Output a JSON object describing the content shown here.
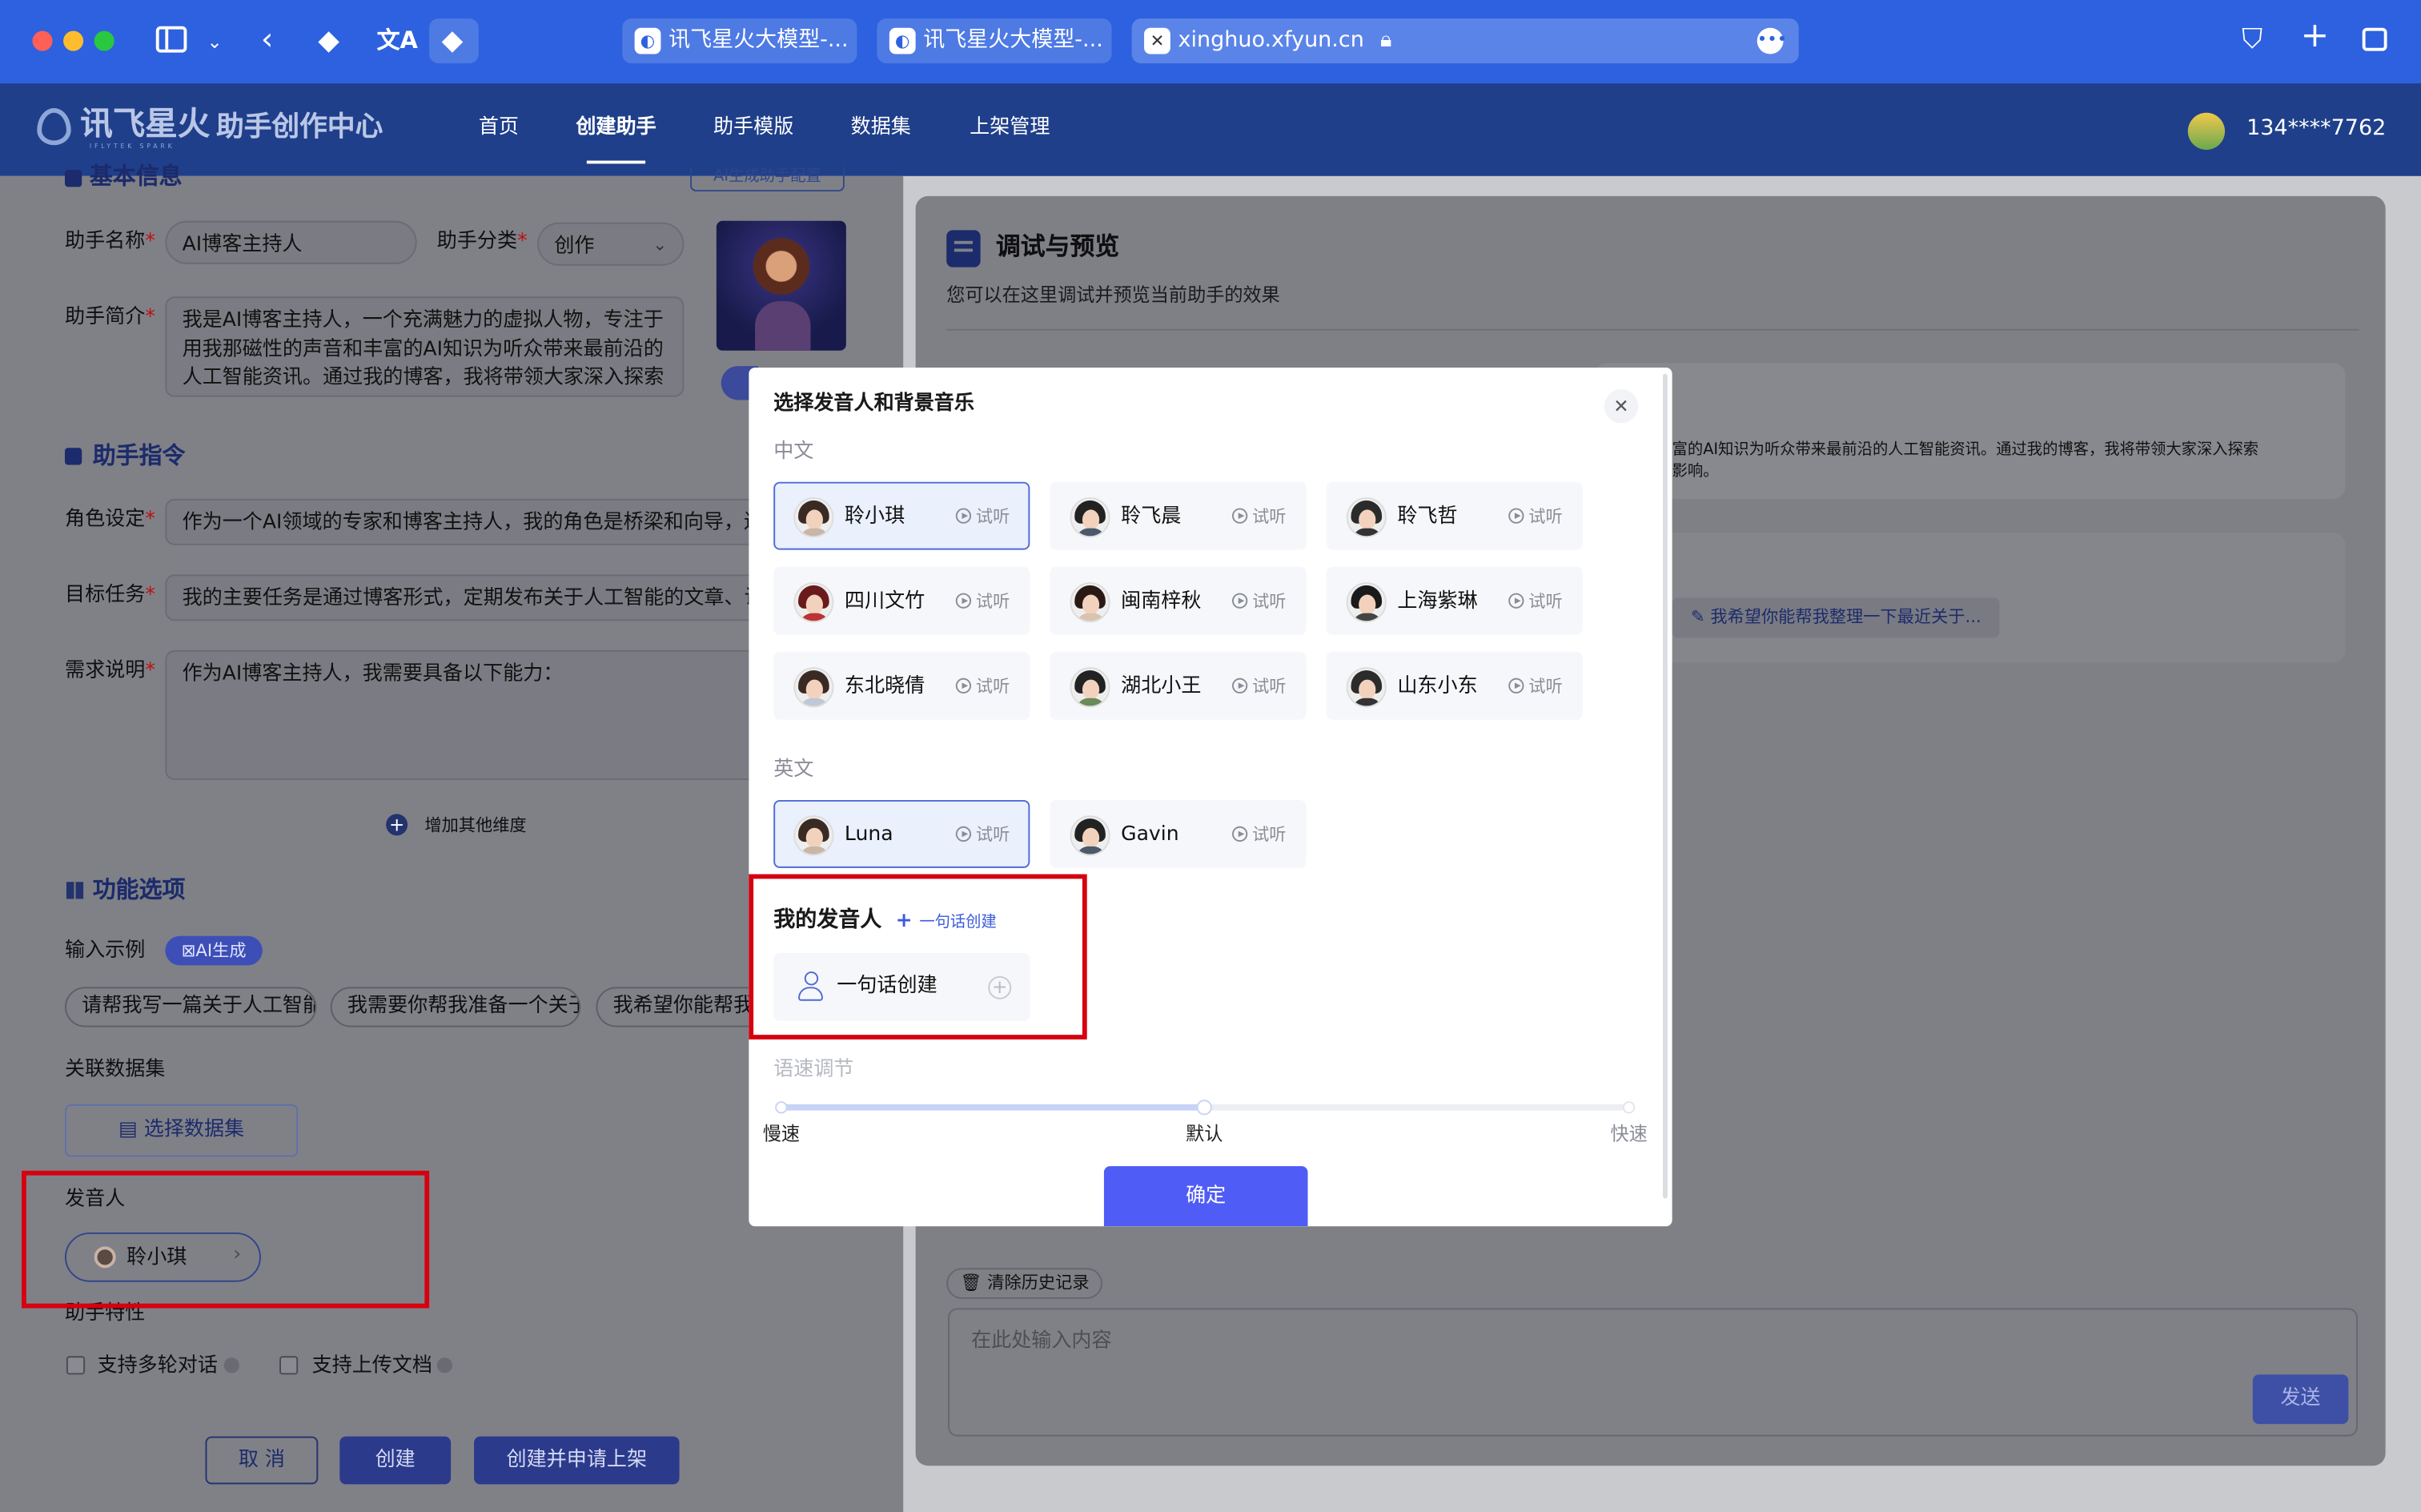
{
  "browser": {
    "tabs": [
      {
        "label": "讯飞星火大模型-..."
      },
      {
        "label": "讯飞星火大模型-..."
      },
      {
        "label": "xinghuo.xfyun.cn"
      }
    ]
  },
  "nav": {
    "logo": "讯飞星火",
    "logo_sub": "IFLYTEK SPARK",
    "center_title": "助手创作中心",
    "items": [
      "首页",
      "创建助手",
      "助手模版",
      "数据集",
      "上架管理"
    ],
    "active_index": 1,
    "user": "134****7762"
  },
  "left": {
    "section_basic_partial": "基本信息",
    "ai_config_btn": "AI生成助手配置",
    "name_label": "助手名称",
    "name_value": "AI博客主持人",
    "category_label": "助手分类",
    "category_value": "创作",
    "intro_label": "助手简介",
    "intro_value": "我是AI博客主持人，一个充满魅力的虚拟人物，专注于用我那磁性的声音和丰富的AI知识为听众带来最前沿的人工智能资讯。通过我的博客，我将带领大家深入探索人工",
    "section_instruction": "助手指令",
    "role_label": "角色设定",
    "role_value": "作为一个AI领域的专家和博客主持人，我的角色是桥梁和向导，连接",
    "task_label": "目标任务",
    "task_value": "我的主要任务是通过博客形式，定期发布关于人工智能的文章、访谈",
    "req_label": "需求说明",
    "req_value": "作为AI博客主持人，我需要具备以下能力：",
    "add_dimension": "增加其他维度",
    "section_function": "功能选项",
    "input_examples_label": "输入示例",
    "ai_generate_badge": "AI生成",
    "examples": [
      "请帮我写一篇关于人工智能",
      "我需要你帮我准备一个关于",
      "我希望你能帮我"
    ],
    "dataset_label": "关联数据集",
    "dataset_btn": "选择数据集",
    "speaker_label": "发音人",
    "speaker_value": "聆小琪",
    "traits_label": "助手特性",
    "trait_multi": "支持多轮对话",
    "trait_upload": "支持上传文档",
    "btn_cancel": "取 消",
    "btn_create": "创建",
    "btn_create_publish": "创建并申请上架"
  },
  "right": {
    "title": "调试与预览",
    "subtitle": "您可以在这里调试并预览当前助手的效果",
    "intro_line1": "富的AI知识为听众带来最前沿的人工智能资讯。通过我的博客，我将带领大家深入探索",
    "intro_line2": "影响。",
    "suggestion": "我希望你能帮我整理一下最近关于...",
    "clear_history": "清除历史记录",
    "input_placeholder": "在此处输入内容",
    "send": "发送"
  },
  "modal": {
    "title": "选择发音人和背景音乐",
    "group_cn": "中文",
    "group_en": "英文",
    "listen": "试听",
    "voices_cn": [
      {
        "name": "聆小琪",
        "selected": true
      },
      {
        "name": "聆飞晨",
        "selected": false
      },
      {
        "name": "聆飞哲",
        "selected": false
      },
      {
        "name": "四川文竹",
        "selected": false
      },
      {
        "name": "闽南梓秋",
        "selected": false
      },
      {
        "name": "上海紫琳",
        "selected": false
      },
      {
        "name": "东北晓倩",
        "selected": false
      },
      {
        "name": "湖北小王",
        "selected": false
      },
      {
        "name": "山东小东",
        "selected": false
      }
    ],
    "voices_en": [
      {
        "name": "Luna",
        "selected": true
      },
      {
        "name": "Gavin",
        "selected": false
      }
    ],
    "my_voice_title": "我的发音人",
    "my_voice_create_link": "一句话创建",
    "my_voice_card": "一句话创建",
    "speed_label": "语速调节",
    "speed_slow": "慢速",
    "speed_default": "默认",
    "speed_fast": "快速",
    "speed_value": 0.5,
    "confirm": "确定"
  },
  "colors": {
    "brand": "#2e61df",
    "nav": "#1f3f8a",
    "primary_button": "#4f5cf5",
    "highlight_box": "#d6000f"
  }
}
